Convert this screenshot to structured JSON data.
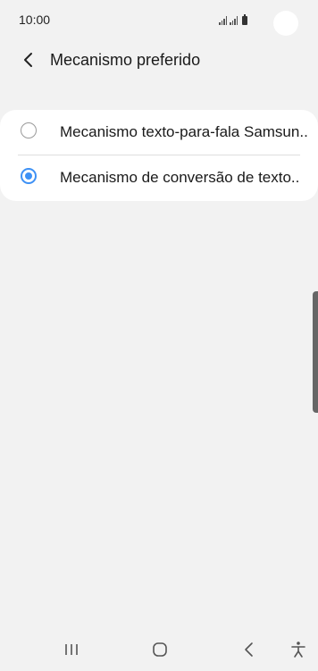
{
  "status_bar": {
    "time": "10:00",
    "icons": [
      "signal-icon",
      "signal-icon",
      "battery-icon"
    ]
  },
  "header": {
    "back_icon": "chevron-left-icon",
    "title": "Mecanismo preferido"
  },
  "options": [
    {
      "label": "Mecanismo texto-para-fala Samsun..",
      "selected": false
    },
    {
      "label": "Mecanismo de conversão de texto..",
      "selected": true
    }
  ],
  "colors": {
    "background": "#f2f2f2",
    "card": "#ffffff",
    "accent": "#3e91f5",
    "text": "#1a1a1a"
  },
  "nav_bar": {
    "buttons": [
      "recent-apps-icon",
      "home-icon",
      "back-icon",
      "accessibility-icon"
    ]
  }
}
